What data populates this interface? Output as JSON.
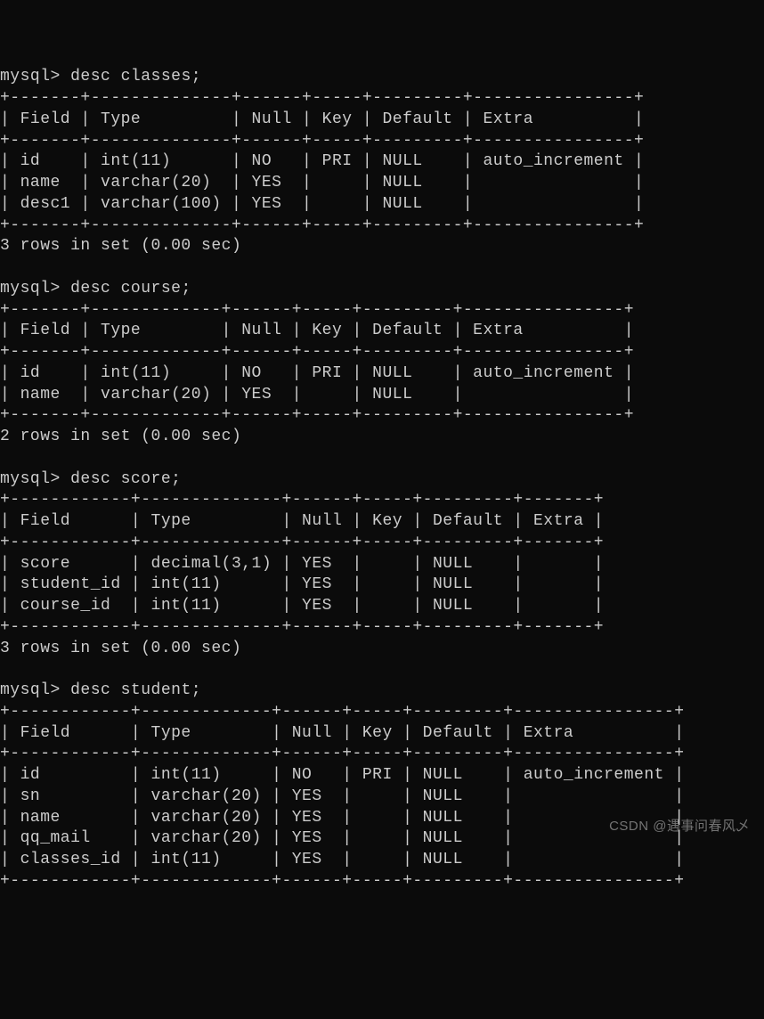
{
  "prompt": "mysql>",
  "commands": {
    "c1": "desc classes;",
    "c2": "desc course;",
    "c3": "desc score;",
    "c4": "desc student;"
  },
  "footers": {
    "f1": "3 rows in set (0.00 sec)",
    "f2": "2 rows in set (0.00 sec)",
    "f3": "3 rows in set (0.00 sec)"
  },
  "tables": {
    "classes": {
      "border": "+-------+--------------+------+-----+---------+----------------+",
      "header": "| Field | Type         | Null | Key | Default | Extra          |",
      "rows": [
        "| id    | int(11)      | NO   | PRI | NULL    | auto_increment |",
        "| name  | varchar(20)  | YES  |     | NULL    |                |",
        "| desc1 | varchar(100) | YES  |     | NULL    |                |"
      ]
    },
    "course": {
      "border": "+-------+-------------+------+-----+---------+----------------+",
      "header": "| Field | Type        | Null | Key | Default | Extra          |",
      "rows": [
        "| id    | int(11)     | NO   | PRI | NULL    | auto_increment |",
        "| name  | varchar(20) | YES  |     | NULL    |                |"
      ]
    },
    "score": {
      "border": "+------------+--------------+------+-----+---------+-------+",
      "header": "| Field      | Type         | Null | Key | Default | Extra |",
      "rows": [
        "| score      | decimal(3,1) | YES  |     | NULL    |       |",
        "| student_id | int(11)      | YES  |     | NULL    |       |",
        "| course_id  | int(11)      | YES  |     | NULL    |       |"
      ]
    },
    "student": {
      "border": "+------------+-------------+------+-----+---------+----------------+",
      "header": "| Field      | Type        | Null | Key | Default | Extra          |",
      "rows": [
        "| id         | int(11)     | NO   | PRI | NULL    | auto_increment |",
        "| sn         | varchar(20) | YES  |     | NULL    |                |",
        "| name       | varchar(20) | YES  |     | NULL    |                |",
        "| qq_mail    | varchar(20) | YES  |     | NULL    |                |",
        "| classes_id | int(11)     | YES  |     | NULL    |                |"
      ]
    }
  },
  "watermark": "CSDN @遇事问春风乄"
}
